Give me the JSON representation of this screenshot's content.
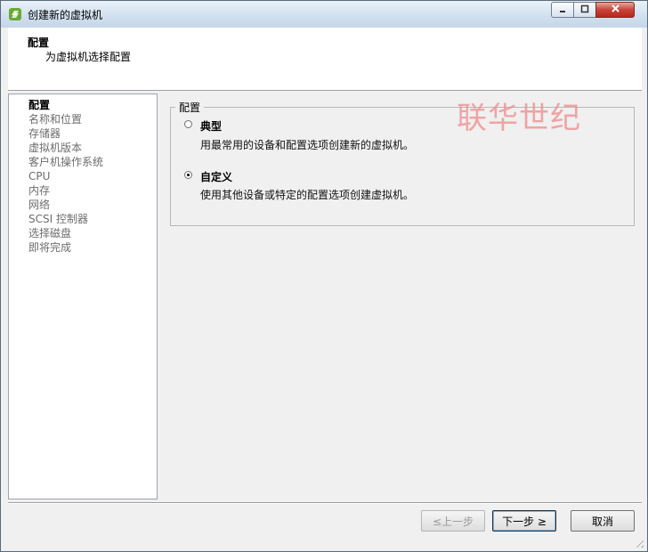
{
  "window": {
    "title": "创建新的虚拟机",
    "minimize_label": "▭",
    "maximize_label": "▢",
    "close_label": "✕"
  },
  "header": {
    "title": "配置",
    "subtitle": "为虚拟机选择配置"
  },
  "sidebar": {
    "items": [
      {
        "label": "配置",
        "active": true
      },
      {
        "label": "名称和位置"
      },
      {
        "label": "存储器"
      },
      {
        "label": "虚拟机版本"
      },
      {
        "label": "客户机操作系统"
      },
      {
        "label": "CPU"
      },
      {
        "label": "内存"
      },
      {
        "label": "网络"
      },
      {
        "label": "SCSI 控制器"
      },
      {
        "label": "选择磁盘"
      },
      {
        "label": "即将完成"
      }
    ]
  },
  "config_group": {
    "label": "配置",
    "options": [
      {
        "label": "典型",
        "description": "用最常用的设备和配置选项创建新的虚拟机。",
        "checked": false
      },
      {
        "label": "自定义",
        "description": "使用其他设备或特定的配置选项创建虚拟机。",
        "checked": true
      }
    ]
  },
  "watermark": "联华世纪",
  "buttons": {
    "back": "≤上一步",
    "next": "下一步 ≥",
    "cancel": "取消"
  },
  "colors": {
    "watermark": "#f08a8a",
    "titlebar": "#cfdfee"
  }
}
